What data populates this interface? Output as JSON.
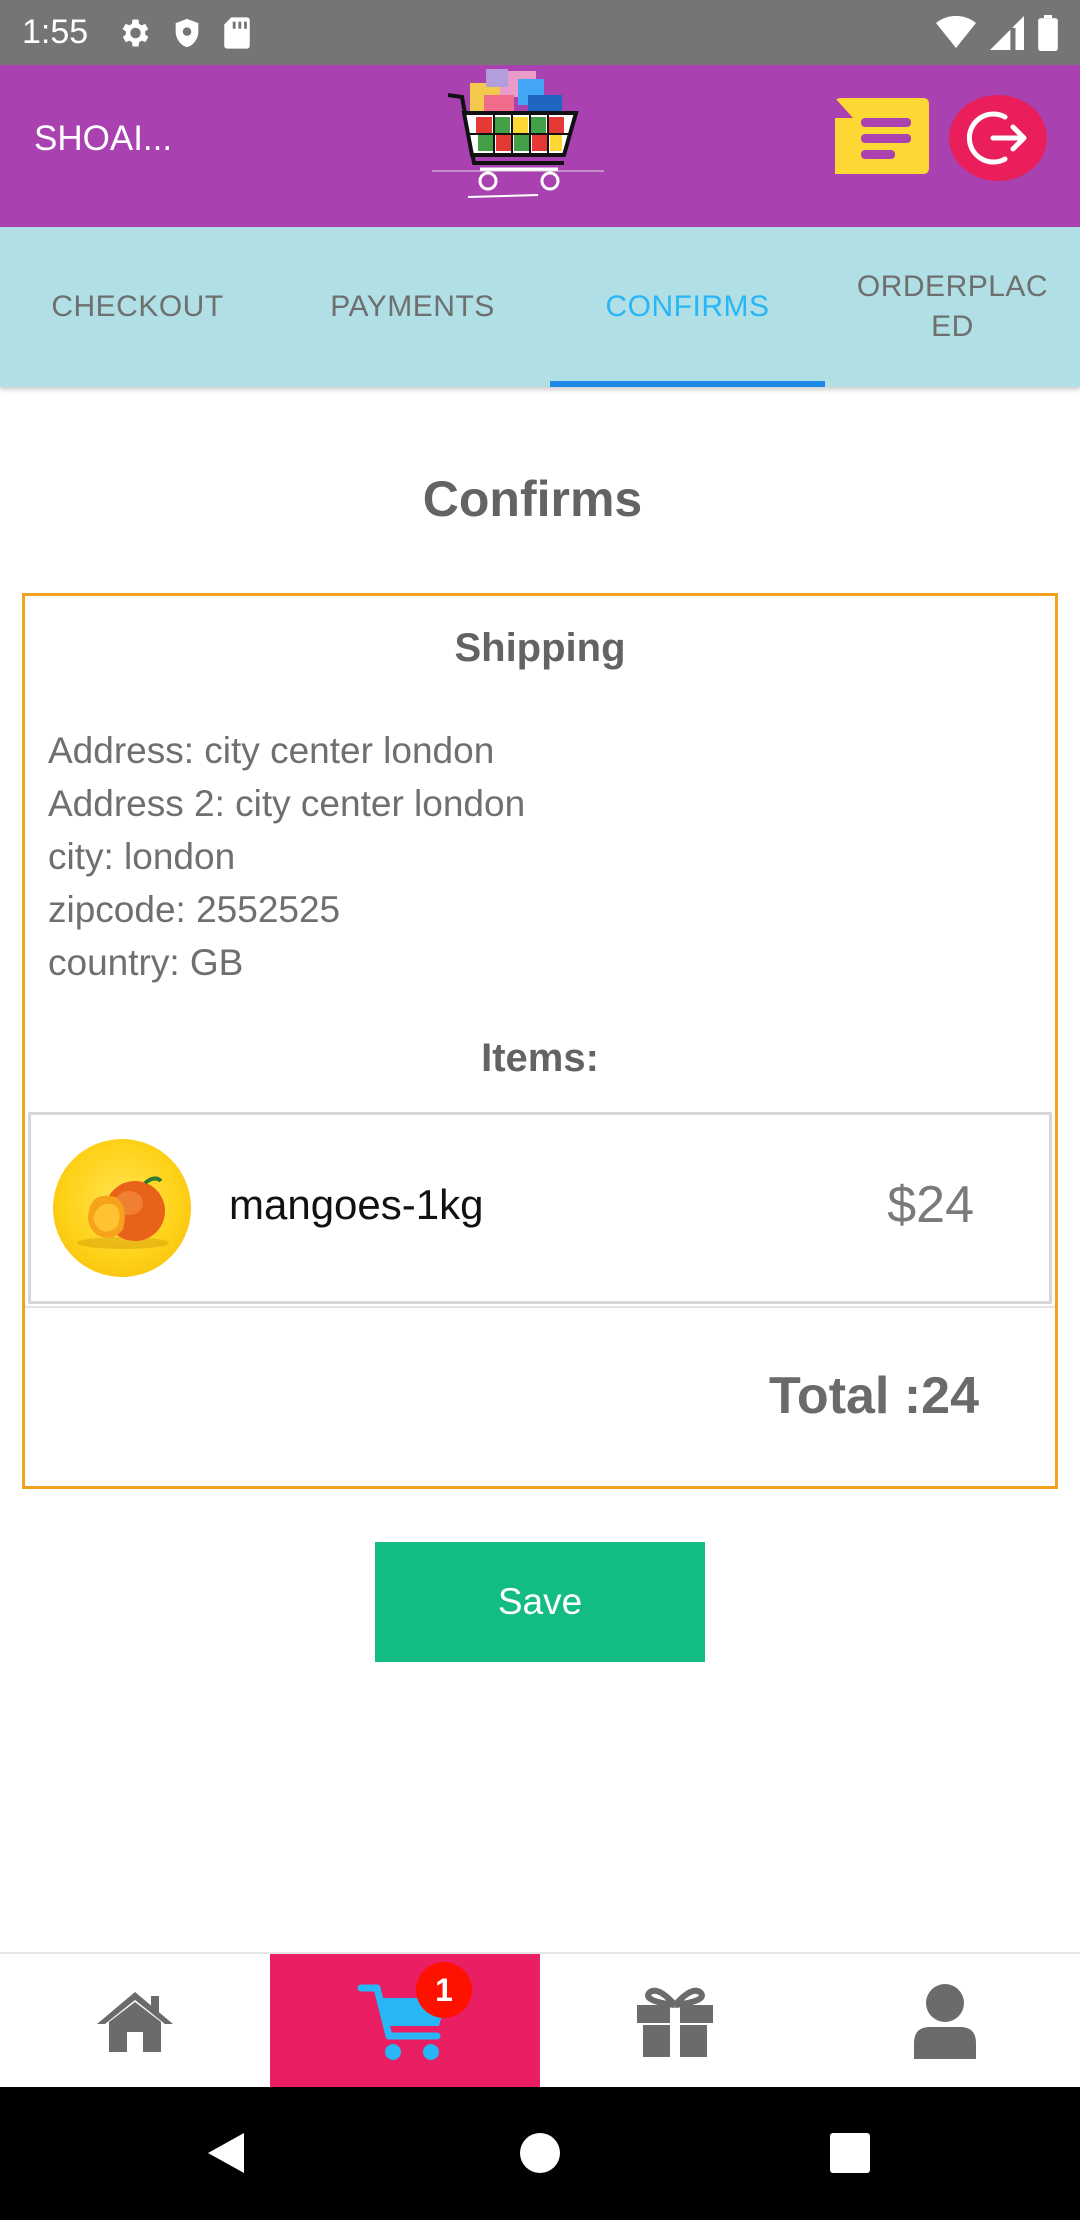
{
  "status_bar": {
    "time": "1:55",
    "left_icons": [
      "settings-icon",
      "shield-icon",
      "sd-card-icon"
    ],
    "right_icons": [
      "wifi-icon",
      "signal-icon",
      "battery-icon"
    ]
  },
  "app_bar": {
    "title": "SHOAI...",
    "logo": "shopping-cart-logo",
    "actions": [
      "notes-icon",
      "logout-icon"
    ],
    "accent_color": "#a941b0"
  },
  "tabs": [
    {
      "label": "CHECKOUT",
      "active": false
    },
    {
      "label": "PAYMENTS",
      "active": false
    },
    {
      "label": "CONFIRMS",
      "active": true
    },
    {
      "label": "ORDERPLACED",
      "line1": "ORDERPLAC",
      "line2": "ED",
      "active": false
    }
  ],
  "page": {
    "title": "Confirms",
    "shipping": {
      "heading": "Shipping",
      "lines": [
        "Address: city center  london",
        "Address 2: city center  london",
        "city: london",
        "zipcode: 2552525",
        "country: GB"
      ]
    },
    "items_heading": "Items:",
    "items": [
      {
        "name": "mangoes-1kg",
        "price": "$24",
        "thumbnail": "mango-image"
      }
    ],
    "total": "Total :24",
    "save_label": "Save"
  },
  "bottom_nav": {
    "items": [
      "home-icon",
      "cart-icon",
      "gift-icon",
      "profile-icon"
    ],
    "active": "cart-icon",
    "cart_badge": "1",
    "active_color": "#e91e63"
  },
  "system_nav": [
    "back-icon",
    "home-circle-icon",
    "recents-icon"
  ]
}
